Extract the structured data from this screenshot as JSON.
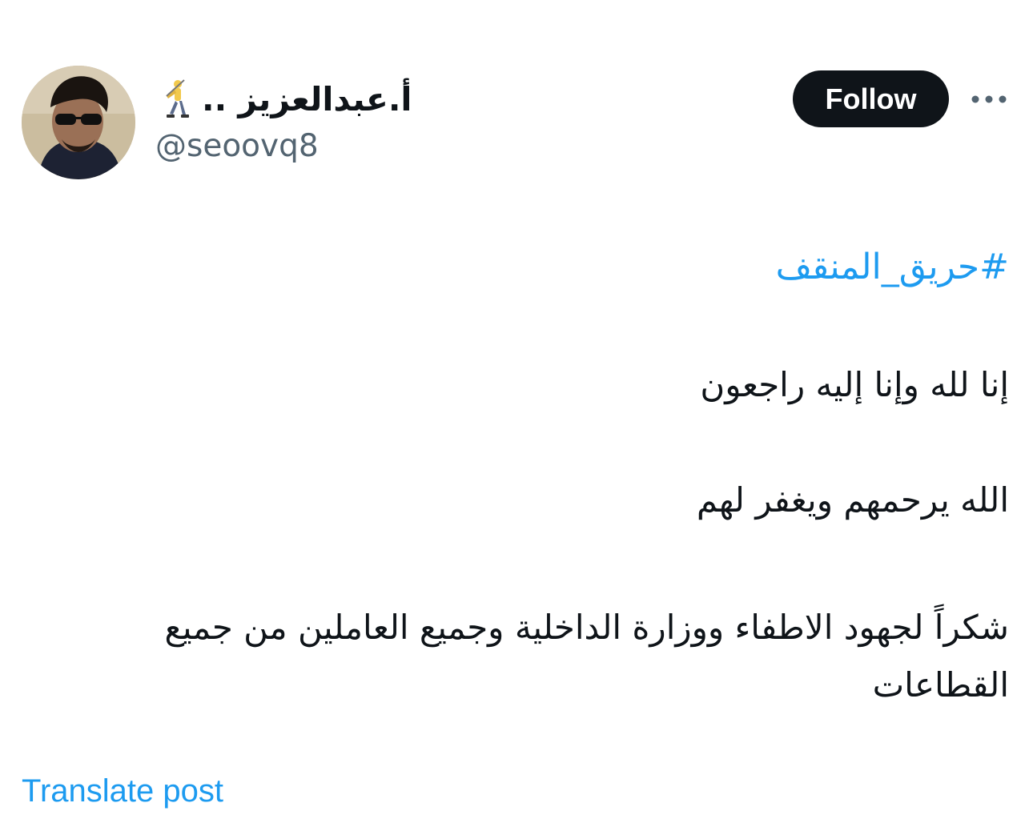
{
  "author": {
    "display_name": "أ.عبدالعزيز ..",
    "name_emoji": "golfer-icon",
    "handle": "@seoovq8"
  },
  "actions": {
    "follow_label": "Follow",
    "more_icon": "more-horizontal-icon"
  },
  "post": {
    "hashtag": "#حريق_المنقف",
    "line1": "إنا لله وإنا إليه راجعون",
    "line2": "الله يرحمهم  ويغفر لهم",
    "line3": "شكراً لجهود الاطفاء ووزارة الداخلية وجميع العاملين من جميع القطاعات"
  },
  "footer": {
    "translate_label": "Translate post"
  },
  "colors": {
    "link": "#1d9bf0",
    "text": "#0f1419",
    "secondary": "#536471",
    "button_bg": "#0f1419"
  }
}
